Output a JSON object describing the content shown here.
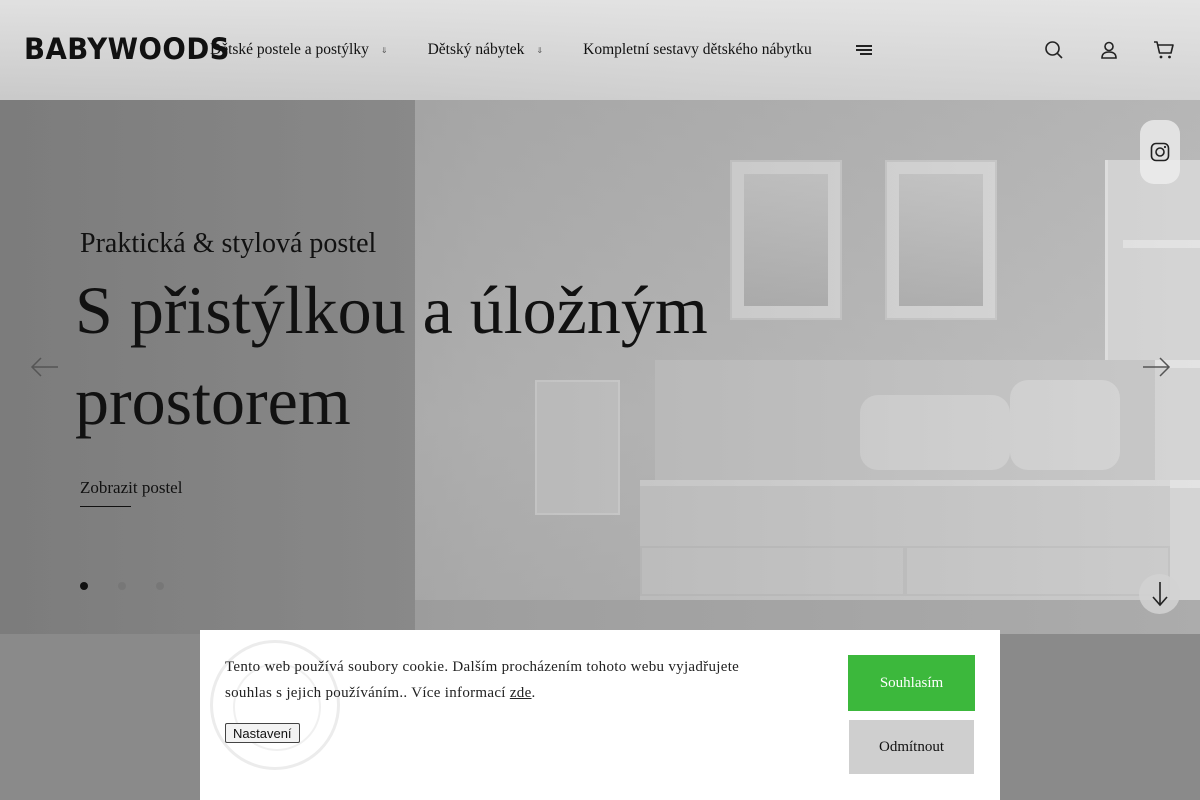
{
  "header": {
    "logo": "BABYWOODS",
    "nav": [
      {
        "label": "Dětské postele a postýlky",
        "has_dropdown": true
      },
      {
        "label": "Dětský nábytek",
        "has_dropdown": true
      },
      {
        "label": "Kompletní sestavy dětského nábytku",
        "has_dropdown": false
      }
    ],
    "icons": [
      "search-icon",
      "user-icon",
      "cart-icon"
    ]
  },
  "hero": {
    "subtitle": "Praktická & stylová postel",
    "title": "S přistýlkou a úložným prostorem",
    "cta": "Zobrazit postel",
    "slides_count": 3,
    "active_slide": 1
  },
  "cookie": {
    "text": "Tento web používá soubory cookie. Dalším procházením tohoto webu vyjadřujete souhlas s jejich používáním.. Více informací ",
    "link": "zde",
    "text_end": ".",
    "settings": "Nastavení",
    "accept": "Souhlasím",
    "decline": "Odmítnout"
  },
  "colors": {
    "accept_button": "#3cb83c",
    "decline_button": "#cfcfcf"
  }
}
